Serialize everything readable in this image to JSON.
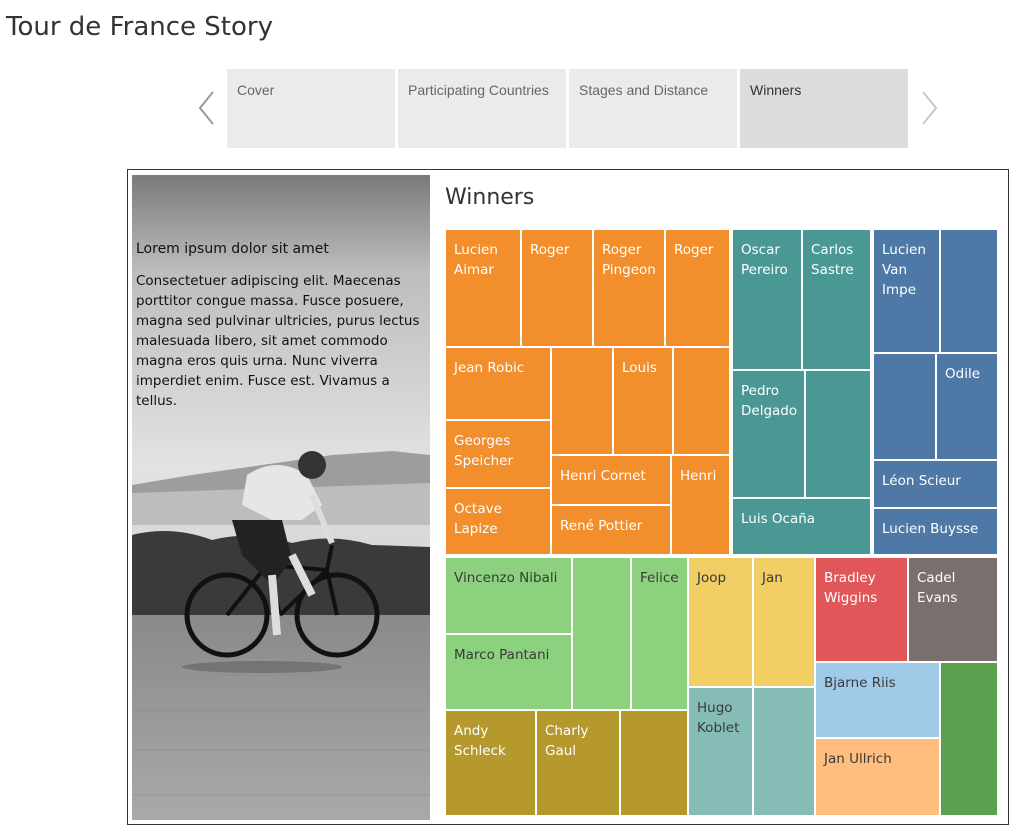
{
  "story": {
    "title": "Tour de France Story"
  },
  "tabs": [
    {
      "label": "Cover"
    },
    {
      "label": "Participating Countries"
    },
    {
      "label": "Stages and Distance"
    },
    {
      "label": "Winners"
    }
  ],
  "text_panel": {
    "heading": "Lorem ipsum dolor sit amet",
    "body": "Consectetuer adipiscing elit. Maecenas porttitor congue massa. Fusce posuere, magna sed pulvinar ultricies, purus lectus malesuada libero, sit amet commodo magna eros quis urna. Nunc viverra imperdiet enim. Fusce est. Vivamus a tellus."
  },
  "chart": {
    "title": "Winners"
  },
  "colors": {
    "orange": "#f28e2b",
    "teal": "#499894",
    "blue": "#4e79a7",
    "green": "#8cd17d",
    "olive": "#b6992d",
    "yellow": "#f1ce63",
    "light_teal": "#86bcb6",
    "red": "#e15759",
    "gray": "#79706e",
    "light_blue": "#a0cbe8",
    "peach": "#ffbe7d",
    "dark_green": "#59a14f"
  },
  "chart_data": {
    "type": "treemap",
    "title": "Winners",
    "cells": [
      {
        "label": "Lucien\nAimar",
        "color": "orange"
      },
      {
        "label": "Roger",
        "color": "orange"
      },
      {
        "label": "Roger\nPingeon",
        "color": "orange"
      },
      {
        "label": "Roger",
        "color": "orange"
      },
      {
        "label": "Jean Robic",
        "color": "orange"
      },
      {
        "label": "",
        "color": "orange"
      },
      {
        "label": "Louis",
        "color": "orange"
      },
      {
        "label": "",
        "color": "orange"
      },
      {
        "label": "Georges\nSpeicher",
        "color": "orange"
      },
      {
        "label": "Henri Cornet",
        "color": "orange"
      },
      {
        "label": "Henri",
        "color": "orange"
      },
      {
        "label": "Octave\nLapize",
        "color": "orange"
      },
      {
        "label": "René Pottier",
        "color": "orange"
      },
      {
        "label": "Oscar\nPereiro",
        "color": "teal"
      },
      {
        "label": "Carlos\nSastre",
        "color": "teal"
      },
      {
        "label": "Pedro\nDelgado",
        "color": "teal"
      },
      {
        "label": "",
        "color": "teal"
      },
      {
        "label": "Luis Ocaña",
        "color": "teal"
      },
      {
        "label": "Lucien\nVan\nImpe",
        "color": "blue"
      },
      {
        "label": "",
        "color": "blue"
      },
      {
        "label": "",
        "color": "blue"
      },
      {
        "label": "Odile",
        "color": "blue"
      },
      {
        "label": "Léon Scieur",
        "color": "blue"
      },
      {
        "label": "Lucien Buysse",
        "color": "blue"
      },
      {
        "label": "Vincenzo Nibali",
        "color": "green"
      },
      {
        "label": "",
        "color": "green"
      },
      {
        "label": "Felice",
        "color": "green"
      },
      {
        "label": "Marco Pantani",
        "color": "green"
      },
      {
        "label": "Andy\nSchleck",
        "color": "olive"
      },
      {
        "label": "Charly\nGaul",
        "color": "olive"
      },
      {
        "label": "",
        "color": "olive"
      },
      {
        "label": "Joop",
        "color": "yellow"
      },
      {
        "label": "Jan",
        "color": "yellow"
      },
      {
        "label": "Hugo\nKoblet",
        "color": "light_teal"
      },
      {
        "label": "",
        "color": "light_teal"
      },
      {
        "label": "Bradley\nWiggins",
        "color": "red"
      },
      {
        "label": "Cadel\nEvans",
        "color": "gray"
      },
      {
        "label": "Bjarne Riis",
        "color": "light_blue"
      },
      {
        "label": "Jan Ullrich",
        "color": "peach"
      },
      {
        "label": "",
        "color": "dark_green"
      }
    ]
  }
}
